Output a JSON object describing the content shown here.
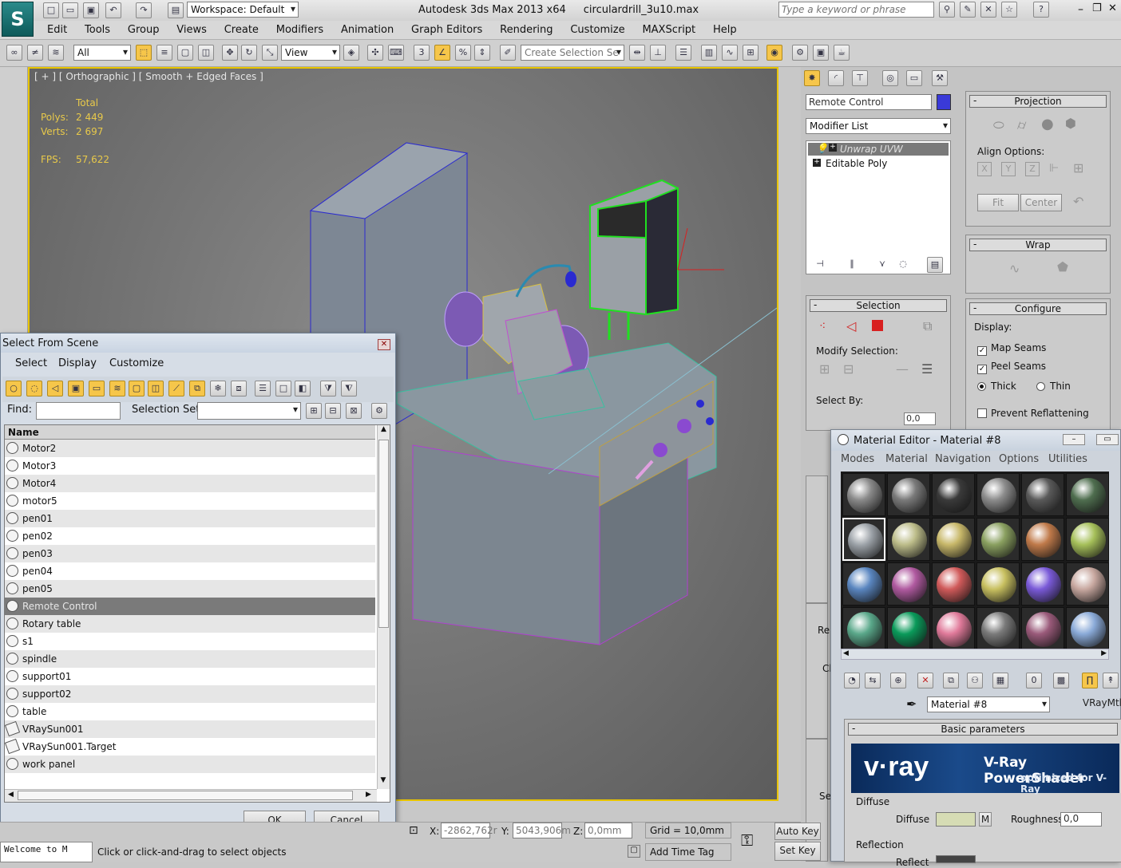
{
  "app": {
    "title": "Autodesk 3ds Max  2013 x64",
    "file": "circulardrill_3u10.max",
    "workspace": "Workspace: Default",
    "search_placeholder": "Type a keyword or phrase"
  },
  "menu": [
    "Edit",
    "Tools",
    "Group",
    "Views",
    "Create",
    "Modifiers",
    "Animation",
    "Graph Editors",
    "Rendering",
    "Customize",
    "MAXScript",
    "Help"
  ],
  "toolbar": {
    "filter": "All",
    "ref_coord": "View",
    "selection_set": "Create Selection Se"
  },
  "viewport": {
    "label": "[ + ] [ Orthographic ] [ Smooth + Edged Faces ]",
    "stats": {
      "total_label": "Total",
      "polys_label": "Polys:",
      "polys": "2 449",
      "verts_label": "Verts:",
      "verts": "2 697",
      "fps_label": "FPS:",
      "fps": "57,622"
    }
  },
  "command_panel": {
    "object_name": "Remote Control",
    "object_color": "#3a3ad8",
    "modifier_list": "Modifier List",
    "stack": [
      {
        "label": "Unwrap UVW",
        "active": true
      },
      {
        "label": "Editable Poly",
        "active": false
      }
    ],
    "projection": {
      "title": "Projection",
      "align_label": "Align Options:",
      "fit": "Fit",
      "center": "Center"
    },
    "wrap": {
      "title": "Wrap"
    },
    "selection": {
      "title": "Selection",
      "modify_label": "Modify Selection:",
      "select_by": "Select By:",
      "angle_value": "0,0"
    },
    "configure": {
      "title": "Configure",
      "display_label": "Display:",
      "map_seams": "Map Seams",
      "peel_seams": "Peel Seams",
      "thick": "Thick",
      "thin": "Thin",
      "prevent": "Prevent Reflattening"
    },
    "partial_labels": {
      "re": "Re",
      "cl": "Cl",
      "se": "Se"
    }
  },
  "select_dialog": {
    "title": "Select From Scene",
    "menu": [
      "Select",
      "Display",
      "Customize"
    ],
    "find_label": "Find:",
    "selset_label": "Selection Set:",
    "col_name": "Name",
    "items": [
      {
        "name": "Motor2",
        "selected": false
      },
      {
        "name": "Motor3",
        "selected": false
      },
      {
        "name": "Motor4",
        "selected": false
      },
      {
        "name": "motor5",
        "selected": false
      },
      {
        "name": "pen01",
        "selected": false
      },
      {
        "name": "pen02",
        "selected": false
      },
      {
        "name": "pen03",
        "selected": false
      },
      {
        "name": "pen04",
        "selected": false
      },
      {
        "name": "pen05",
        "selected": false
      },
      {
        "name": "Remote Control",
        "selected": true
      },
      {
        "name": "Rotary table",
        "selected": false
      },
      {
        "name": "s1",
        "selected": false
      },
      {
        "name": "spindle",
        "selected": false
      },
      {
        "name": "support01",
        "selected": false
      },
      {
        "name": "support02",
        "selected": false
      },
      {
        "name": "table",
        "selected": false
      },
      {
        "name": "VRaySun001",
        "selected": false
      },
      {
        "name": "VRaySun001.Target",
        "selected": false
      },
      {
        "name": "work panel",
        "selected": false
      }
    ],
    "ok": "OK",
    "cancel": "Cancel"
  },
  "material_editor": {
    "title": "Material Editor - Material #8",
    "menu": [
      "Modes",
      "Material",
      "Navigation",
      "Options",
      "Utilities"
    ],
    "material_name": "Material #8",
    "material_type": "VRayMtl",
    "basic_params": "Basic parameters",
    "vray_logo": "v·ray",
    "vray_title": "V-Ray PowerShader",
    "vray_sub": "optimized for V-Ray",
    "diffuse_group": "Diffuse",
    "diffuse_label": "Diffuse",
    "diffuse_map": "M",
    "roughness_label": "Roughness",
    "roughness": "0,0",
    "reflection_group": "Reflection",
    "reflect_label": "Reflect",
    "swatches": [
      "#8a8a8a",
      "#7a7a7a",
      "#3a3a3a",
      "#8c8c8c",
      "#5a5a5a",
      "#4f6e4f",
      "#9aa0a6",
      "#bdbd8a",
      "#c8b86a",
      "#8aa060",
      "#c07a4a",
      "#a6c05a",
      "#5a86c0",
      "#b05aa0",
      "#d05a5a",
      "#c8c060",
      "#7a5ad8",
      "#c8a8a0",
      "#5aa88a",
      "#0a9a5a",
      "#e07a9a",
      "#7a7a7a",
      "#9a5a7a",
      "#8aaad8"
    ]
  },
  "status": {
    "welcome": "Welcome to M",
    "prompt": "Click or click-and-drag to select objects",
    "x_label": "X:",
    "x": "-2862,762r",
    "y_label": "Y:",
    "y": "5043,906m",
    "z_label": "Z:",
    "z": "0,0mm",
    "grid": "Grid = 10,0mm",
    "add_time_tag": "Add Time Tag",
    "auto_key": "Auto Key",
    "set_key": "Set Key"
  }
}
